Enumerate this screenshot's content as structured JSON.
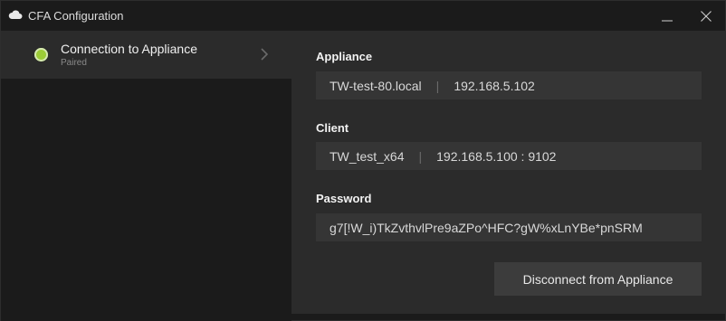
{
  "window": {
    "title": "CFA Configuration",
    "app_icon": "cloud-icon"
  },
  "sidebar": {
    "items": [
      {
        "label": "Connection to Appliance",
        "status": "Paired",
        "status_color": "#9ccc37",
        "icon": "chevron-right-icon"
      }
    ]
  },
  "main": {
    "appliance": {
      "label": "Appliance",
      "hostname": "TW-test-80.local",
      "separator": "|",
      "ip": "192.168.5.102"
    },
    "client": {
      "label": "Client",
      "hostname": "TW_test_x64",
      "separator": "|",
      "address": "192.168.5.100 : 9102"
    },
    "password": {
      "label": "Password",
      "value": "g7[!W_i)TkZvthvlPre9aZPo^HFC?gW%xLnYBe*pnSRM"
    },
    "disconnect_label": "Disconnect from Appliance"
  },
  "colors": {
    "background": "#1b1b1b",
    "panel": "#2b2b2b",
    "field": "#353535",
    "button": "#3c3c3c",
    "accent_status": "#9ccc37"
  }
}
